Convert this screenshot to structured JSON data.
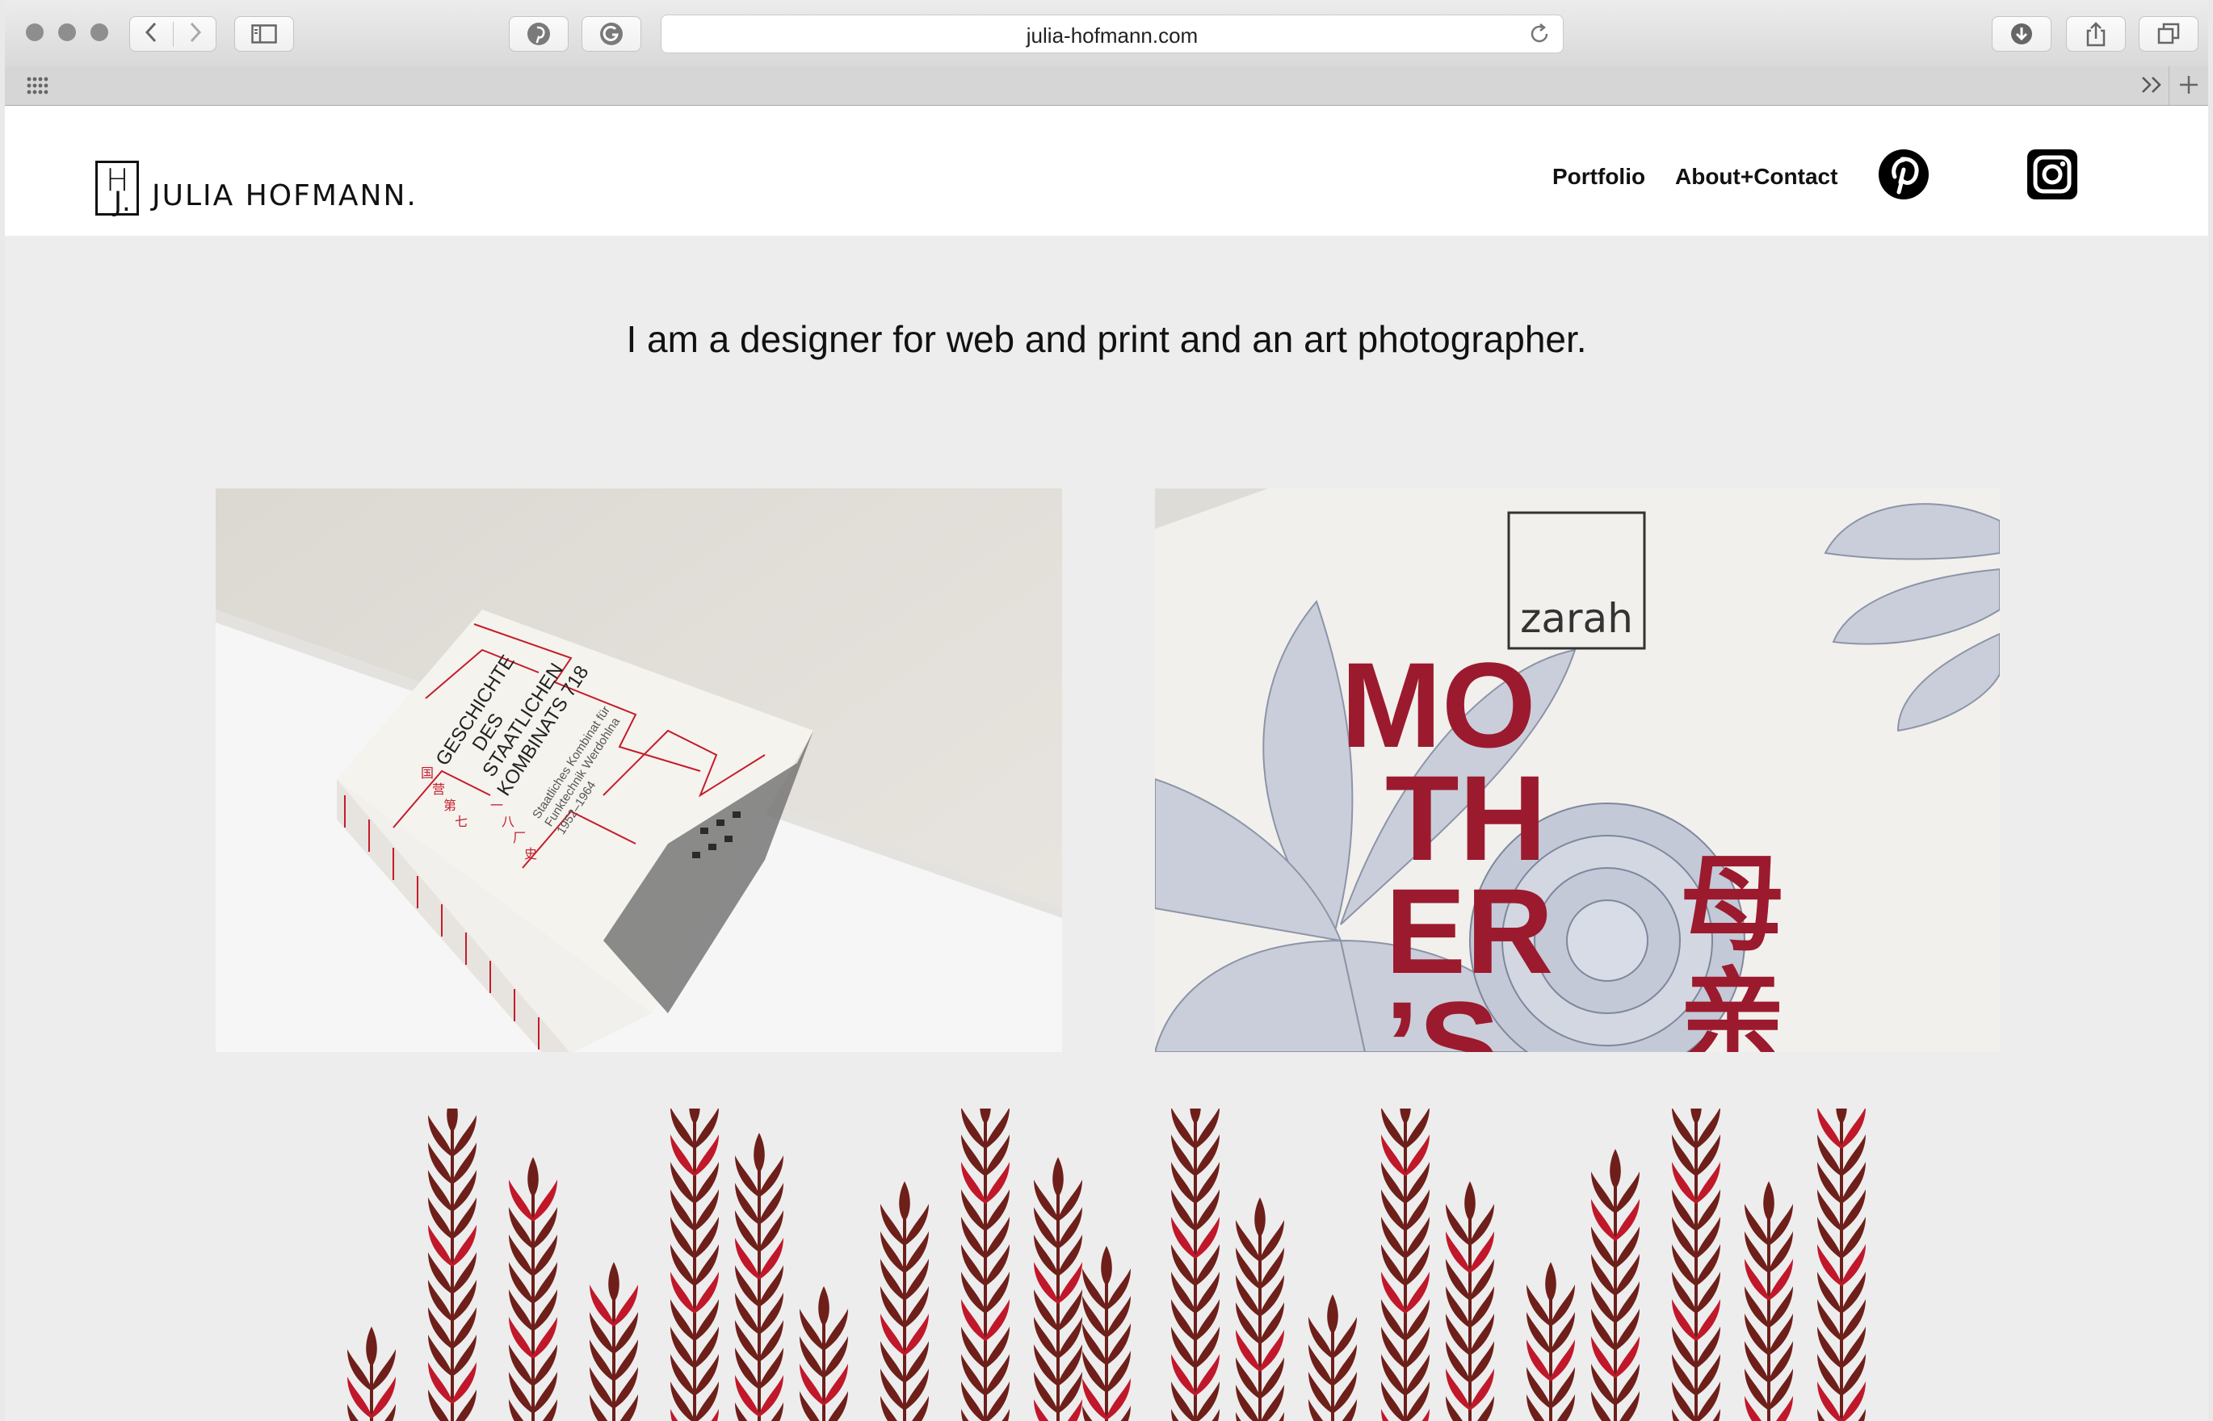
{
  "browser": {
    "url": "julia-hofmann.com"
  },
  "site": {
    "logo_text": "JULIA HOFMANN.",
    "logo_mark": {
      "h": "H",
      "j": "J."
    },
    "nav": {
      "portfolio": "Portfolio",
      "about_contact": "About+Contact"
    },
    "tagline": "I am a designer for web and print and an art photographer."
  },
  "portfolio": {
    "book": {
      "title_lines": [
        "GESCHICHTE",
        "DES",
        "STAATLICHEN",
        "KOMBINATS 718"
      ],
      "chinese_lines": [
        "国",
        "营",
        "第",
        "七",
        "一",
        "八",
        "厂",
        "史"
      ],
      "subtitle_lines": [
        "Staatliches Kombinat für",
        "Funktechnik Werdohlna",
        "1952–1964"
      ]
    },
    "poster": {
      "brand": "zarah",
      "word_lines": [
        "MO",
        "TH",
        "ER",
        "’S"
      ],
      "chinese": [
        "母",
        "亲"
      ]
    }
  },
  "colors": {
    "accent_red": "#9c1a2e",
    "wheat_dark": "#6e1f1a",
    "wheat_red": "#c0182a",
    "page_bg": "#ededed"
  },
  "icons": {
    "pinterest": "pinterest-icon",
    "instagram": "instagram-icon"
  }
}
